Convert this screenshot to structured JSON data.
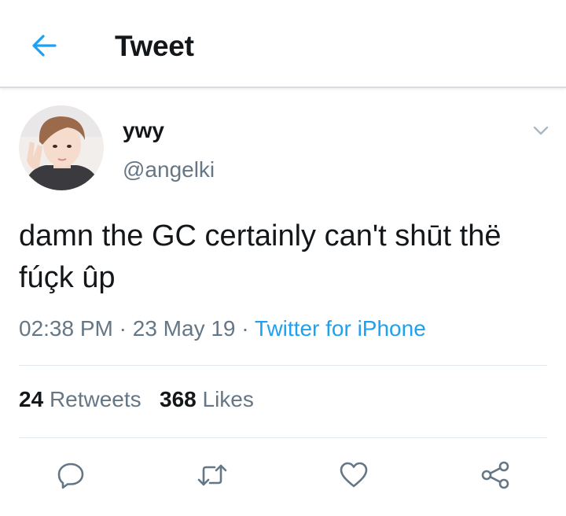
{
  "header": {
    "title": "Tweet",
    "back_icon": "arrow-left-icon",
    "accent_color": "#1da1f2"
  },
  "tweet": {
    "display_name": "ywy",
    "handle": "@angelki",
    "text": "damn the GC certainly can't shūt thë fúçk ûp",
    "time": "02:38 PM",
    "date": "23 May 19",
    "source": "Twitter for iPhone",
    "separator": "·",
    "retweets_count": "24",
    "retweets_label": "Retweets",
    "likes_count": "368",
    "likes_label": "Likes"
  },
  "actions": [
    "reply-icon",
    "retweet-icon",
    "like-icon",
    "share-icon"
  ]
}
